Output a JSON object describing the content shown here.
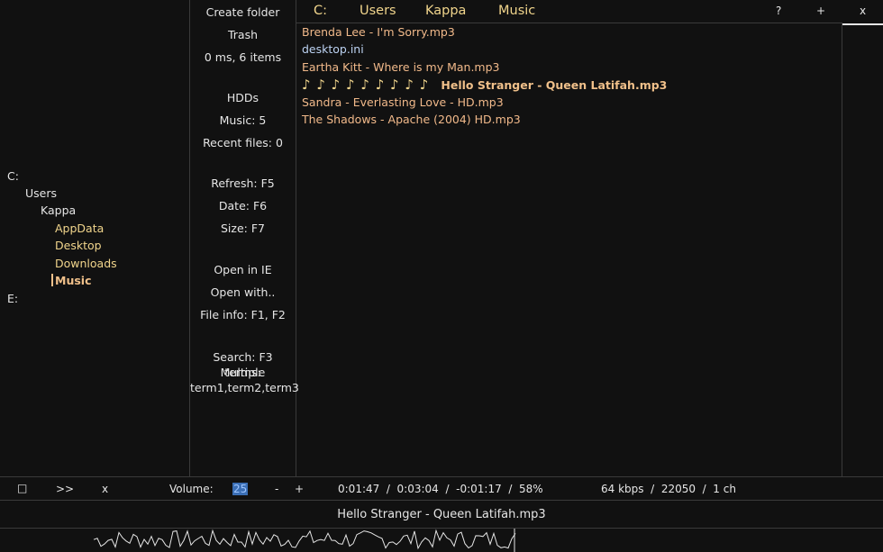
{
  "tree": {
    "drive_c": "C:",
    "users": "Users",
    "kappa": "Kappa",
    "appdata": "AppData",
    "desktop": "Desktop",
    "downloads": "Downloads",
    "music": "Music",
    "drive_e": "E:"
  },
  "middle": {
    "create_folder": "Create folder",
    "trash": "Trash",
    "stats": "0 ms,  6 items",
    "hdds": "HDDs",
    "music_count": "Music: 5",
    "recent_files": "Recent files: 0",
    "refresh": "Refresh: F5",
    "date": "Date: F6",
    "size": "Size: F7",
    "open_ie": "Open in IE",
    "open_with": "Open with..",
    "file_info": "File info: F1, F2",
    "search_1": "Search: F3 Multiple",
    "search_2": "terms:",
    "search_3": "term1,term2,term3"
  },
  "breadcrumb": {
    "c": "C:",
    "users": "Users",
    "kappa": "Kappa",
    "music": "Music"
  },
  "top_buttons": {
    "help": "?",
    "add": "+",
    "close": "x"
  },
  "files": [
    {
      "name": "Brenda Lee - I'm Sorry.mp3"
    },
    {
      "name": "desktop.ini"
    },
    {
      "name": "Eartha Kitt - Where is my Man.mp3"
    },
    {
      "name": "Hello Stranger - Queen Latifah.mp3",
      "prefix": "♪ ♪ ♪  ♪ ♪ ♪  ♪ ♪ ♪"
    },
    {
      "name": "Sandra - Everlasting Love - HD.mp3"
    },
    {
      "name": "The Shadows - Apache (2004) HD.mp3"
    }
  ],
  "controls": {
    "stop": "□",
    "next": ">>",
    "close": "x",
    "volume_label": "Volume:",
    "volume_value": "25",
    "vol_down": "-",
    "vol_up": "+",
    "time": "0:01:47  /  0:03:04  /  -0:01:17  /  58%",
    "bitrate": "64 kbps  /  22050  /  1 ch"
  },
  "now_playing": "Hello Stranger - Queen Latifah.mp3",
  "progress": 0.58
}
